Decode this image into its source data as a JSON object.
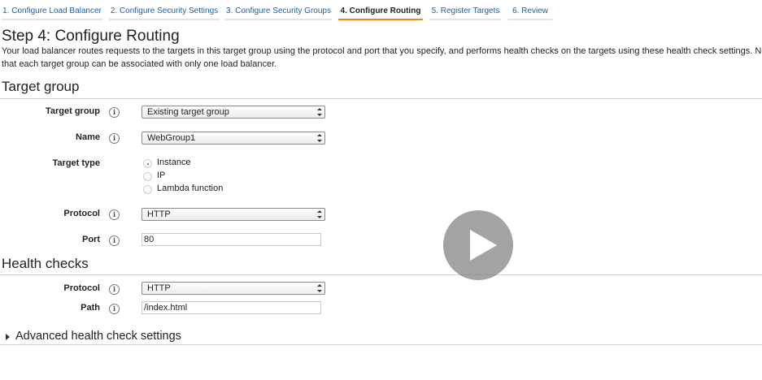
{
  "wizard": {
    "steps": [
      {
        "label": "1. Configure Load Balancer"
      },
      {
        "label": "2. Configure Security Settings"
      },
      {
        "label": "3. Configure Security Groups"
      },
      {
        "label": "4. Configure Routing",
        "active": true
      },
      {
        "label": "5. Register Targets"
      },
      {
        "label": "6. Review"
      }
    ],
    "active_color": "#eb8c17"
  },
  "page": {
    "title": "Step 4: Configure Routing",
    "description": "Your load balancer routes requests to the targets in this target group using the protocol and port that you specify, and performs health checks on the targets using these health check settings. Note that each target group can be associated with only one load balancer."
  },
  "target_group": {
    "section_title": "Target group",
    "target_group_label": "Target group",
    "target_group_value": "Existing target group",
    "name_label": "Name",
    "name_value": "WebGroup1",
    "target_type_label": "Target type",
    "target_type_options": [
      "Instance",
      "IP",
      "Lambda function"
    ],
    "target_type_selected": "Instance",
    "protocol_label": "Protocol",
    "protocol_value": "HTTP",
    "port_label": "Port",
    "port_value": "80"
  },
  "health_checks": {
    "section_title": "Health checks",
    "protocol_label": "Protocol",
    "protocol_value": "HTTP",
    "path_label": "Path",
    "path_value": "/index.html",
    "advanced_label": "Advanced health check settings"
  },
  "icons": {
    "info": "info-icon",
    "play": "play-icon",
    "expand": "caret-right-icon"
  }
}
